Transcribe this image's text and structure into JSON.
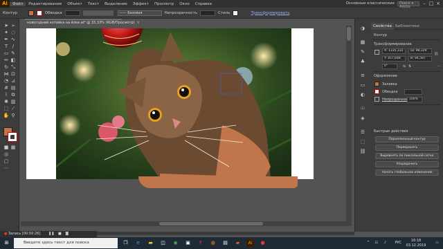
{
  "menubar": {
    "logo": "Ai",
    "items": [
      "Файл",
      "Редактирование",
      "Объект",
      "Текст",
      "Выделение",
      "Эффект",
      "Просмотр",
      "Окно",
      "Справка"
    ],
    "workspace": "Основные классические",
    "search_placeholder": "Поиск в Adobe Stock"
  },
  "controlbar": {
    "label": "Контур",
    "stroke_label": "Обводка",
    "stroke_value": "",
    "style_label": "Базовая",
    "opacity_label": "Непрозрачность",
    "style_field_label": "Стиль",
    "transform_label": "Трансформировать",
    "fill_color": "#c0754a"
  },
  "document": {
    "tab_title": "новогодний котейка на ёлке.ai* @ 33,33% (RGB/Просмотр)",
    "close": "×"
  },
  "panel": {
    "tabs": [
      "Свойства",
      "Библиотеки"
    ],
    "section_label": "Контур",
    "transform_title": "Трансформирование",
    "x": "X: 1335,332 ",
    "y": "Y: 457,648 ",
    "w": "Ш: 98,329 ",
    "h": "В: 94,587 ",
    "angle": "0°",
    "appearance_title": "Оформление",
    "fill_label": "Заливка",
    "stroke_label": "Обводка",
    "opacity_label": "Непрозрачность",
    "opacity_value": "100%",
    "quick_title": "Быстрые действия",
    "buttons": [
      "Параллельный контур",
      "Перекрасить",
      "Выровнять по пиксельной сетке",
      "Упорядочить",
      "Начать глобальное изменение"
    ],
    "fill_color": "#c0754a",
    "stroke_color": "#ffffff"
  },
  "recording": {
    "label": "Запись [00:50:26]"
  },
  "taskbar": {
    "search_placeholder": "Введите здесь текст для поиска",
    "lang": "РУС",
    "time": "16:18",
    "date": "03.12.2019"
  }
}
